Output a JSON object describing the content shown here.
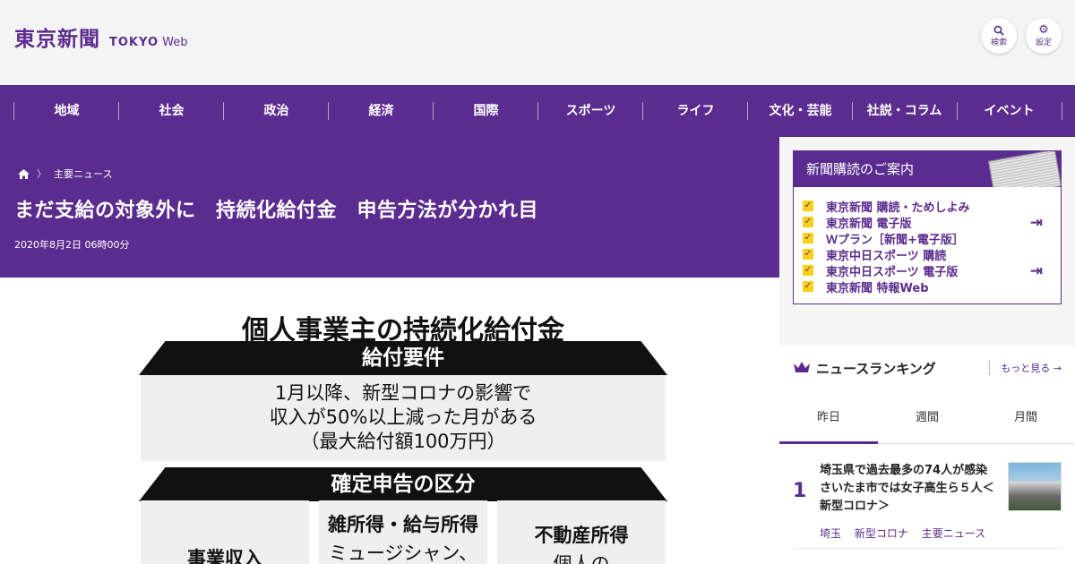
{
  "header": {
    "logo_jp": "東京新聞",
    "logo_en_bold": "TOKYO",
    "logo_en_light": "Web",
    "search_label": "検索",
    "settings_label": "設定"
  },
  "nav": [
    "地域",
    "社会",
    "政治",
    "経済",
    "国際",
    "スポーツ",
    "ライフ",
    "文化・芸能",
    "社説・コラム",
    "イベント"
  ],
  "article": {
    "breadcrumb": "主要ニュース",
    "title": "まだ支給の対象外に　持続化給付金　申告方法が分かれ目",
    "date": "2020年8月2日 06時00分"
  },
  "figure": {
    "title": "個人事業主の持続化給付金",
    "band1": "給付要件",
    "requirement": [
      "1月以降、新型コロナの影響で",
      "収入が50%以上減った月がある",
      "（最大給付額100万円）"
    ],
    "band2": "確定申告の区分",
    "col1": "事業収入",
    "col2_title": "雑所得・給与所得",
    "col2_sub": "ミュージシャン、",
    "col3_title": "不動産所得",
    "col3_sub": "個人の"
  },
  "subscription": {
    "title": "新聞購読のご案内",
    "items": [
      "東京新聞 購読・ためしよみ",
      "東京新聞 電子版",
      "Ｗプラン［新聞+電子版］",
      "東京中日スポーツ 購読",
      "東京中日スポーツ 電子版",
      "東京新聞 特報Web"
    ]
  },
  "ranking": {
    "title": "ニュースランキング",
    "more": "もっと見る",
    "tabs": [
      "昨日",
      "週間",
      "月間"
    ],
    "items": [
      {
        "rank": "1",
        "text": "埼玉県で過去最多の74人が感染　さいたま市では女子高生ら５人＜新型コロナ＞",
        "tags": [
          "埼玉",
          "新型コロナ",
          "主要ニュース"
        ]
      }
    ]
  },
  "colors": {
    "brand": "#5b2c8f",
    "check": "#f7d117"
  }
}
